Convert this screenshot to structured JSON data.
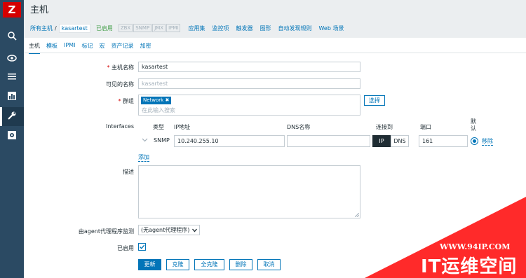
{
  "sidebar": {
    "logo": "Z",
    "icons": [
      "search-icon",
      "eye-icon",
      "list-icon",
      "chart-icon",
      "wrench-icon",
      "settings-icon"
    ]
  },
  "header": {
    "title": "主机"
  },
  "breadcrumb": {
    "all_hosts": "所有主机",
    "separator": "/",
    "current": "kasartest",
    "status": "已启用",
    "availability": [
      "ZBX",
      "SNMP",
      "JMX",
      "IPMI"
    ],
    "nav": [
      "应用集",
      "监控项",
      "触发器",
      "图形",
      "自动发现规则",
      "Web 场景"
    ]
  },
  "tabs": [
    "主机",
    "模板",
    "IPMI",
    "标记",
    "宏",
    "资产记录",
    "加密"
  ],
  "form": {
    "hostname": {
      "label": "主机名称",
      "value": "kasartest"
    },
    "visible_name": {
      "label": "可见的名称",
      "placeholder": "kasartest"
    },
    "groups": {
      "label": "群组",
      "chip": "Network",
      "placeholder": "在此输入搜索",
      "select_button": "选择"
    },
    "interfaces": {
      "label": "Interfaces",
      "headers": {
        "type": "类型",
        "ip": "IP地址",
        "dns": "DNS名称",
        "connect": "连接到",
        "port": "端口",
        "default": "默认"
      },
      "row": {
        "type": "SNMP",
        "ip": "10.240.255.10",
        "dns": "",
        "connect_ip": "IP",
        "connect_dns": "DNS",
        "port": "161",
        "remove": "移除"
      },
      "add": "添加"
    },
    "description": {
      "label": "描述"
    },
    "proxy": {
      "label": "由agent代理程序监测",
      "value": "(无agent代理程序)"
    },
    "enabled": {
      "label": "已启用"
    },
    "buttons": {
      "update": "更新",
      "clone": "克隆",
      "full_clone": "全克隆",
      "delete": "删除",
      "cancel": "取消"
    }
  },
  "watermark": {
    "url": "WWW.94IP.COM",
    "brand": "IT运维空间"
  }
}
